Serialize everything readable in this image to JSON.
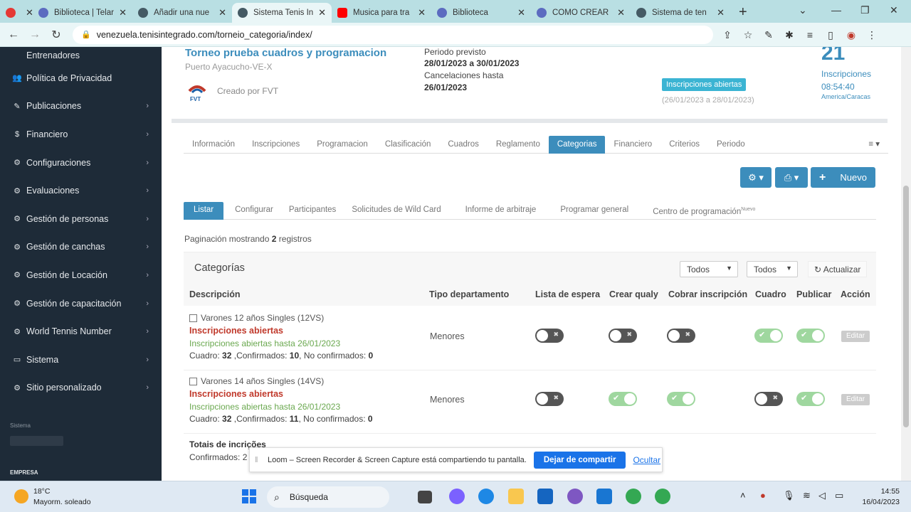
{
  "browser": {
    "tabs": [
      {
        "title": "",
        "color": "#e53935"
      },
      {
        "title": "Biblioteca | Telar",
        "color": "#5c6bc0"
      },
      {
        "title": "Añadir una nue",
        "color": "#455a64"
      },
      {
        "title": "Sistema Tenis In",
        "color": "#455a64"
      },
      {
        "title": "Musica para tra",
        "color": "#ff0000"
      },
      {
        "title": "Biblioteca",
        "color": "#5c6bc0"
      },
      {
        "title": "COMO CREAR",
        "color": "#5c6bc0"
      },
      {
        "title": "Sistema de ten",
        "color": "#455a64"
      }
    ],
    "url": "venezuela.tenisintegrado.com/torneio_categoria/index/"
  },
  "sidebar": {
    "items": [
      {
        "label": "Entrenadores",
        "icon": "user-icon"
      },
      {
        "label": "Política de Privacidad",
        "icon": "users-icon"
      },
      {
        "label": "Publicaciones",
        "icon": "edit-icon"
      },
      {
        "label": "Financiero",
        "icon": "dollar-icon"
      },
      {
        "label": "Configuraciones",
        "icon": "gear-icon"
      },
      {
        "label": "Evaluaciones",
        "icon": "gear-icon"
      },
      {
        "label": "Gestión de personas",
        "icon": "gear-icon"
      },
      {
        "label": "Gestión de canchas",
        "icon": "gear-icon"
      },
      {
        "label": "Gestión de Locación",
        "icon": "gear-icon"
      },
      {
        "label": "Gestión de capacitación",
        "icon": "gear-icon"
      },
      {
        "label": "World Tennis Number",
        "icon": "gear-icon"
      },
      {
        "label": "Sistema",
        "icon": "laptop-icon"
      },
      {
        "label": "Sitio personalizado",
        "icon": "gear-icon"
      }
    ],
    "footer_small": "Sistema",
    "footer_empresa": "EMPRESA"
  },
  "tournament": {
    "title": "Torneo prueba cuadros y programacion",
    "location": "Puerto Ayacucho-VE-X",
    "creator": "Creado por FVT",
    "logo_text": "FVT",
    "periodo_label": "Periodo previsto",
    "periodo_value": "28/01/2023 a 30/01/2023",
    "cancel_label": "Cancelaciones hasta",
    "cancel_value": "26/01/2023",
    "status_badge": "Inscripciones abiertas",
    "status_dates": "(26/01/2023 a 28/01/2023)",
    "inscripciones_count": "21",
    "inscripciones_label": "Inscripciones",
    "time": "08:54:40",
    "timezone": "America/Caracas"
  },
  "main_tabs": [
    "Información",
    "Inscripciones",
    "Programacion",
    "Clasificación",
    "Cuadros",
    "Reglamento",
    "Categorias",
    "Financiero",
    "Criterios",
    "Periodo"
  ],
  "main_tabs_active": "Categorias",
  "menu_icon": "≡",
  "actions": {
    "settings_icon": "⚙",
    "print_icon": "⎙",
    "new_label": "Nuevo"
  },
  "sub_tabs": [
    "Listar",
    "Configurar",
    "Participantes",
    "Solicitudes de Wild Card",
    "Informe de arbitraje",
    "Programar general",
    "Centro de programación"
  ],
  "sub_tabs_new": "Nuevo",
  "pagination": {
    "prefix": "Paginación mostrando",
    "count": "2",
    "suffix": "registros"
  },
  "panel": {
    "title": "Categorías",
    "filter1": "Todos",
    "filter2": "Todos",
    "refresh": "Actualizar"
  },
  "table": {
    "headers": [
      "Descripción",
      "Tipo departamento",
      "Lista de espera",
      "Crear qualy",
      "Cobrar inscripción",
      "Cuadro",
      "Publicar",
      "Acción"
    ],
    "rows": [
      {
        "name": "Varones 12 años Singles (12VS)",
        "status": "Inscripciones abiertas",
        "until": "Inscripciones abiertas hasta 26/01/2023",
        "cuadro": "32",
        "confirmados": "10",
        "no_confirmados": "0",
        "departamento": "Menores",
        "toggles": {
          "lista": false,
          "qualy": false,
          "cobrar": false,
          "cuadro": true,
          "publicar": true
        },
        "action": "Editar"
      },
      {
        "name": "Varones 14 años Singles (14VS)",
        "status": "Inscripciones abiertas",
        "until": "Inscripciones abiertas hasta 26/01/2023",
        "cuadro": "32",
        "confirmados": "11",
        "no_confirmados": "0",
        "departamento": "Menores",
        "toggles": {
          "lista": false,
          "qualy": true,
          "cobrar": true,
          "cuadro": false,
          "publicar": true
        },
        "action": "Editar"
      }
    ],
    "labels": {
      "cuadro": "Cuadro:",
      "confirmados": ",Confirmados:",
      "no_confirmados": ", No confirmados:"
    },
    "totals_title": "Totais de incrições",
    "totals_confirmados": "Confirmados: 2"
  },
  "loom": {
    "message": "Loom – Screen Recorder & Screen Capture está compartiendo tu pantalla.",
    "stop": "Dejar de compartir",
    "hide": "Ocultar"
  },
  "taskbar": {
    "temp": "18°C",
    "weather": "Mayorm. soleado",
    "search": "Búsqueda",
    "time": "14:55",
    "date": "16/04/2023"
  },
  "colors": {
    "accent": "#3c8dbc",
    "sidebar": "#1e2b38",
    "status_red": "#c0392b",
    "status_green": "#6aa84f"
  }
}
